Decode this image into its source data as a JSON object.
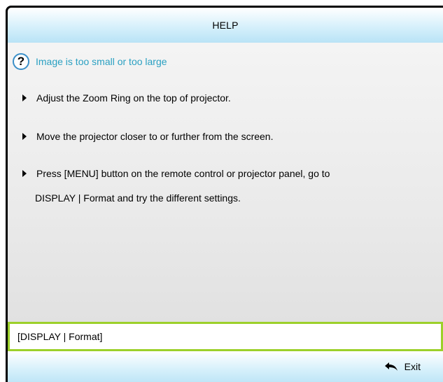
{
  "header": {
    "title": "HELP"
  },
  "topic": {
    "title": "Image is too small or too large",
    "icon": "question-icon"
  },
  "bullets": [
    "Adjust the Zoom Ring on the top of projector.",
    "Move the projector closer to or further from the screen.",
    "Press [MENU] button on the remote control or projector panel, go to"
  ],
  "bullet3_line2": "DISPLAY | Format and try the different settings.",
  "path_box": {
    "text": "[DISPLAY | Format]"
  },
  "footer": {
    "exit_label": "Exit",
    "exit_icon": "return-arrow-icon"
  },
  "colors": {
    "topic_text": "#2aa0c2",
    "highlight_border": "#9cd02a",
    "header_gradient_end": "#b9e3f6",
    "frame": "#000000"
  }
}
